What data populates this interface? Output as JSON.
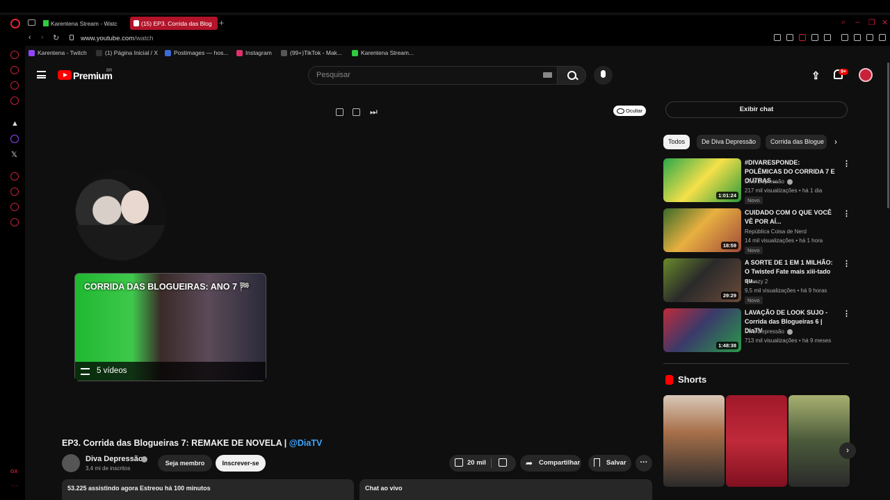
{
  "browser": {
    "tabs": [
      {
        "label": "Karentena Stream - Watc"
      },
      {
        "label": "(15) EP3. Corrida das Blog"
      }
    ],
    "url_host": "www.youtube.com",
    "url_path": "/watch",
    "bookmarks": [
      {
        "label": "Karentena - Twitch",
        "color": "#9146ff"
      },
      {
        "label": "(1) Página Inicial / X",
        "color": "#000000"
      },
      {
        "label": "Postimages — hos...",
        "color": "#3b6bd6"
      },
      {
        "label": "Instagram",
        "color": "#e1306c"
      },
      {
        "label": "(99+)TikTok - Mak...",
        "color": "#222222"
      },
      {
        "label": "Karentena Stream...",
        "color": "#2ecc40"
      }
    ],
    "sidebar_badge": "GX",
    "accent": "#c9203a"
  },
  "header": {
    "logo_label": "Premium",
    "region": "BR",
    "search_placeholder": "Pesquisar",
    "notif_count": "9+"
  },
  "player": {
    "hide_label": "Ocultar",
    "playlist_title": "CORRIDA DAS BLOGUEIRAS: ANO 7 🏁",
    "playlist_count": "5 vídeos"
  },
  "video": {
    "title": "EP3. Corrida das Blogueiras 7: REMAKE DE NOVELA | ",
    "title_tag": "@DiaTV",
    "channel": "Diva Depressão",
    "subs": "3,4 mi de inscritos",
    "member_label": "Seja membro",
    "subscribe_label": "Inscrever-se",
    "likes": "20 mil",
    "share_label": "Compartilhar",
    "save_label": "Salvar",
    "live_info": "53.225 assistindo agora  Estreou há 100 minutos",
    "chat_label": "Chat ao vivo"
  },
  "sidebar": {
    "chat_button": "Exibir chat",
    "chips": [
      "Todos",
      "De Diva Depressão",
      "Corrida das Blogue"
    ],
    "recommendations": [
      {
        "title": "#DIVARESPONDE: POLÊMICAS DO CORRIDA 7 E OUTRAS ...",
        "channel": "Diva Depressão",
        "meta": "217 mil visualizações • há 1 dia",
        "badge": "Novo",
        "duration": "1:01:24",
        "verified": true
      },
      {
        "title": "CUIDADO COM O QUE VOCÊ VÊ POR AÍ...",
        "channel": "República Coisa de Nerd",
        "meta": "14 mil visualizações • há 1 hora",
        "badge": "Novo",
        "duration": "18:59",
        "verified": false
      },
      {
        "title": "A SORTE DE 1 EM 1 MILHÃO: O Twisted Fate mais xiii-tado qu...",
        "channel": "Kennzy 2",
        "meta": "9,5 mil visualizações • há 9 horas",
        "badge": "Novo",
        "duration": "29:29",
        "verified": false
      },
      {
        "title": "LAVAÇÃO DE LOOK SUJO - Corrida das Blogueiras 6 | DiaTV",
        "channel": "Diva Depressão",
        "meta": "713 mil visualizações • há 9 meses",
        "badge": "",
        "duration": "1:48:38",
        "verified": true
      }
    ],
    "shorts_title": "Shorts"
  }
}
